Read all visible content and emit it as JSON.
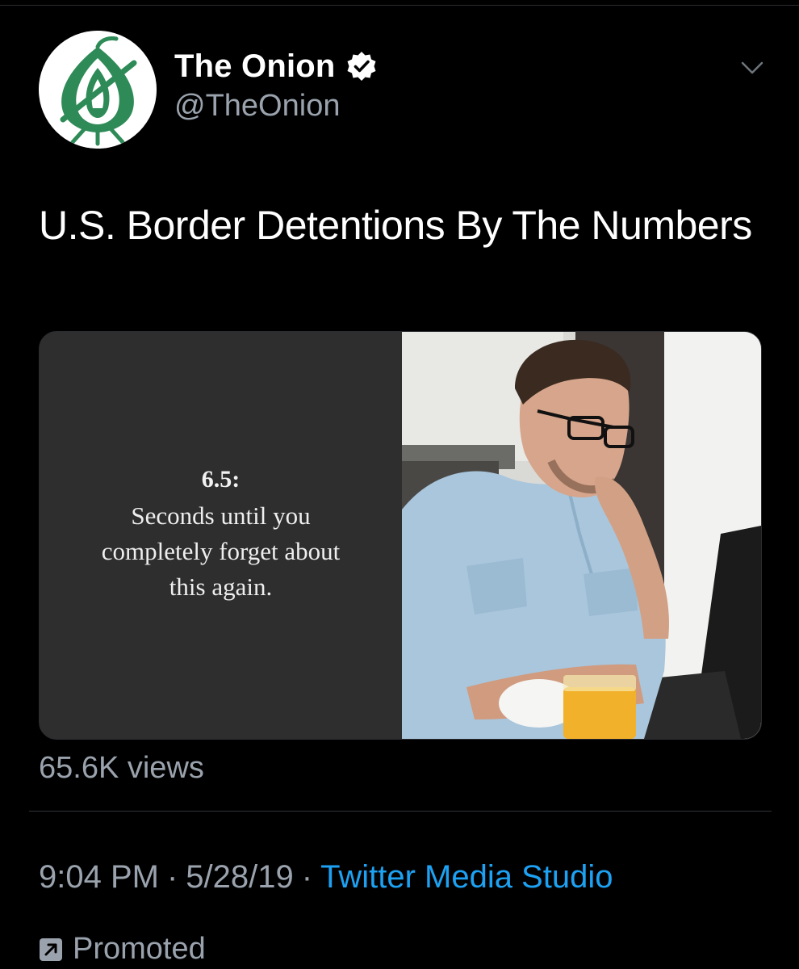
{
  "account": {
    "display_name": "The Onion",
    "handle": "@TheOnion",
    "verified": true,
    "avatar_icon": "onion-logo-icon",
    "brand_color": "#2e8b57"
  },
  "tweet": {
    "text": "U.S. Border Detentions By The Numbers"
  },
  "media": {
    "stat_value": "6.5:",
    "stat_caption": "Seconds until you completely forget about this again."
  },
  "views": "65.6K views",
  "meta": {
    "time": "9:04 PM",
    "separator": "·",
    "date": "5/28/19",
    "source": "Twitter Media Studio",
    "link_color": "#1da1f2"
  },
  "promoted": {
    "label": "Promoted",
    "icon": "promoted-arrow-icon"
  },
  "icons": {
    "verified": "verified-badge-icon",
    "menu": "chevron-down-icon"
  }
}
